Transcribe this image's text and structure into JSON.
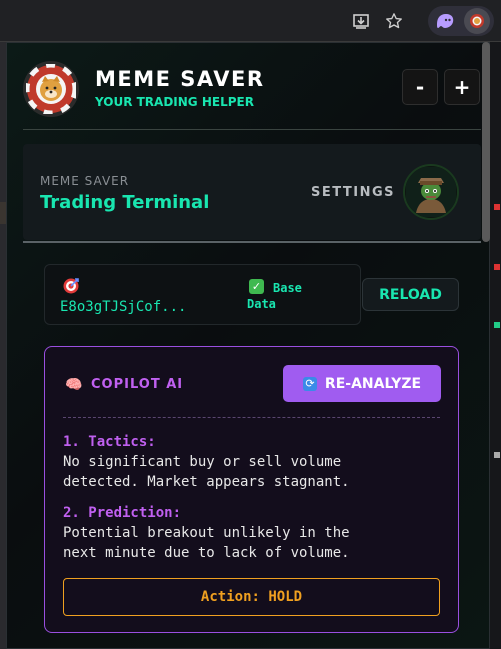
{
  "browser": {
    "icons": [
      "download-icon",
      "star-icon",
      "ghost-extension-icon",
      "meme-extension-icon"
    ]
  },
  "header": {
    "title": "MEME SAVER",
    "subtitle": "YOUR TRADING HELPER",
    "minus_label": "-",
    "plus_label": "+"
  },
  "terminal": {
    "small_label": "MEME SAVER",
    "title": "Trading Terminal",
    "settings_label": "SETTINGS"
  },
  "token": {
    "address": "E8o3gTJSjCof...",
    "data_label": "Base Data",
    "reload_label": "RELOAD"
  },
  "copilot": {
    "title": "COPILOT AI",
    "reanalyze_label": "RE-ANALYZE",
    "tactics_heading": "1. Tactics:",
    "tactics_line1": "No significant buy or sell volume",
    "tactics_line2": "detected. Market appears stagnant.",
    "prediction_heading": "2. Prediction:",
    "prediction_line1": "Potential breakout unlikely in the",
    "prediction_line2": "next minute due to lack of volume.",
    "action": "Action: HOLD"
  },
  "colors": {
    "accent_green": "#19e6b0",
    "accent_purple": "#a05cf0",
    "action_orange": "#f0a020"
  }
}
